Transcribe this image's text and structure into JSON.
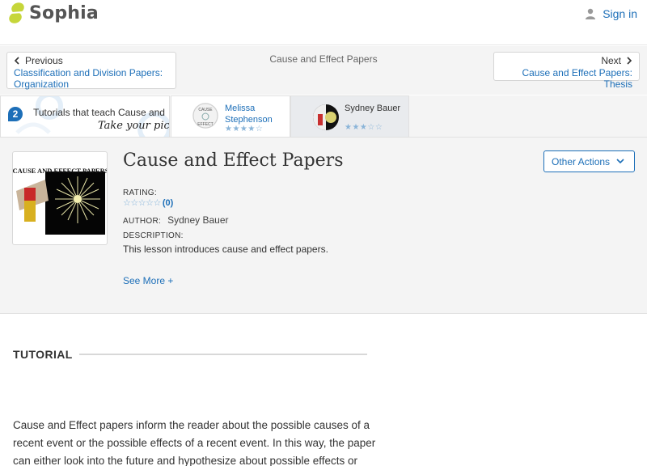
{
  "header": {
    "logo_text": "Sophia",
    "signin_label": "Sign in"
  },
  "nav": {
    "previous_label": "Previous",
    "previous_title": "Classification and Division Papers: Organization",
    "center_title": "Cause and Effect Papers",
    "next_label": "Next",
    "next_title": "Cause and Effect Papers: Thesis"
  },
  "tutorials": {
    "count": "2",
    "text": "Tutorials that teach Cause and",
    "take_pick": "Take your pick:",
    "cards": [
      {
        "name": "Melissa Stephenson",
        "stars": "★★★★☆"
      },
      {
        "name": "Sydney Bauer",
        "stars": "★★★☆☆"
      }
    ]
  },
  "lesson": {
    "thumb_caption": "CAUSE AND EFFECT PAPERS",
    "title": "Cause and Effect Papers",
    "rating_label": "RATING:",
    "rating_stars": "☆☆☆☆☆",
    "rating_count": "(0)",
    "author_label": "AUTHOR:",
    "author_name": "Sydney Bauer",
    "description_label": "DESCRIPTION:",
    "description": "This lesson introduces cause and effect papers.",
    "see_more": "See More +",
    "other_actions": "Other Actions"
  },
  "tutorial_section": {
    "heading": "TUTORIAL",
    "lines": [
      "Cause and Effect papers inform the reader about the possible causes of a",
      "recent event or the possible effects of a recent event. In this way, the paper",
      "can either look into the future and hypothesize about possible effects or"
    ]
  },
  "colors": {
    "link_blue": "#1d6fb8",
    "logo_green": "#c6d63a",
    "panel_bg": "#f4f4f4"
  }
}
